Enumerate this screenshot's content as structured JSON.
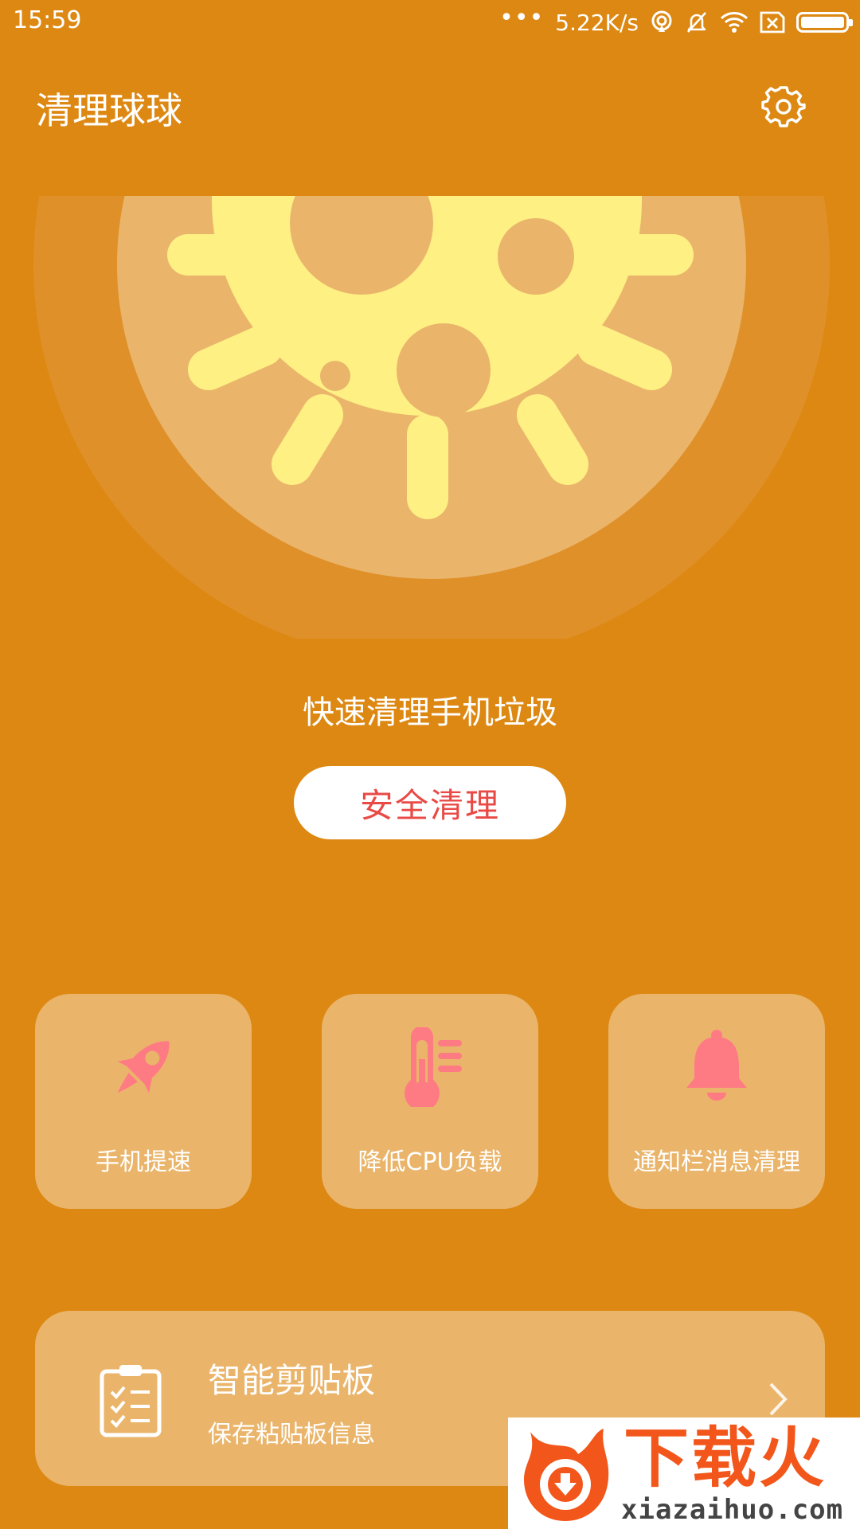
{
  "status_bar": {
    "time": "15:59",
    "dots": "•••",
    "network_speed": "5.22K/s",
    "icons": [
      "hotspot-icon",
      "mute-bell-icon",
      "wifi-icon",
      "sim-off-icon",
      "battery-icon"
    ],
    "battery_level": 1.0
  },
  "app_bar": {
    "title": "清理球球",
    "settings_icon": "gear-icon"
  },
  "hero": {
    "illustration": "virus-icon",
    "tagline": "快速清理手机垃圾",
    "button_label": "安全清理"
  },
  "features": [
    {
      "label": "手机提速",
      "icon": "rocket-icon"
    },
    {
      "label": "降低CPU负载",
      "icon": "thermometer-icon"
    },
    {
      "label": "通知栏消息清理",
      "icon": "bell-icon"
    }
  ],
  "clipboard_card": {
    "title": "智能剪贴板",
    "subtitle": "保存粘贴板信息",
    "icon": "clipboard-checklist-icon",
    "chevron": "chevron-right-icon"
  },
  "watermark": {
    "text": "下载火",
    "url": "xiazaihuo.com"
  },
  "colors": {
    "background": "#dd8812",
    "tile": "#eab56b",
    "accent_red": "#e94a45",
    "icon_pink": "#ff7b84",
    "virus_yellow": "#fef083"
  }
}
